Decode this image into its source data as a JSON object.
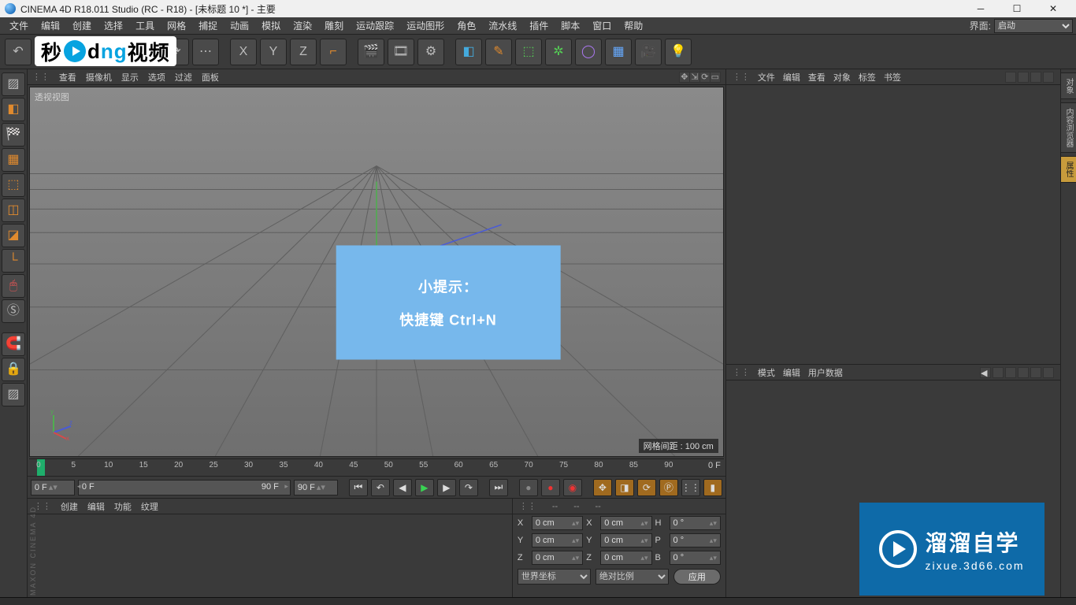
{
  "title": "CINEMA 4D R18.011 Studio (RC - R18) - [未标题 10 *] - 主要",
  "menubar": {
    "items": [
      "文件",
      "编辑",
      "创建",
      "选择",
      "工具",
      "网格",
      "捕捉",
      "动画",
      "模拟",
      "渲染",
      "雕刻",
      "运动跟踪",
      "运动图形",
      "角色",
      "流水线",
      "插件",
      "脚本",
      "窗口",
      "帮助"
    ],
    "layout_label": "界面:",
    "layout_value": "启动"
  },
  "viewport_menu": {
    "items": [
      "查看",
      "摄像机",
      "显示",
      "选项",
      "过滤",
      "面板"
    ],
    "view_label": "透视视图",
    "grid_distance": "网格间距 : 100 cm"
  },
  "tip": {
    "title": "小提示：",
    "body": "快捷键 Ctrl+N"
  },
  "timeline": {
    "ticks": [
      "0",
      "5",
      "10",
      "15",
      "20",
      "25",
      "30",
      "35",
      "40",
      "45",
      "50",
      "55",
      "60",
      "65",
      "70",
      "75",
      "80",
      "85",
      "90"
    ],
    "end_label": "0 F"
  },
  "playbar": {
    "current": "0 F",
    "range_start": "0 F",
    "range_end": "90 F",
    "end_field": "90 F"
  },
  "material_panel": {
    "menu": [
      "创建",
      "编辑",
      "功能",
      "纹理"
    ],
    "brand": "MAXON CINEMA 4D"
  },
  "coord_panel": {
    "headers": [
      "--",
      "--",
      "--"
    ],
    "rows": [
      {
        "axis": "X",
        "pos": "0 cm",
        "size_axis": "X",
        "size": "0 cm",
        "rot_axis": "H",
        "rot": "0 °"
      },
      {
        "axis": "Y",
        "pos": "0 cm",
        "size_axis": "Y",
        "size": "0 cm",
        "rot_axis": "P",
        "rot": "0 °"
      },
      {
        "axis": "Z",
        "pos": "0 cm",
        "size_axis": "Z",
        "size": "0 cm",
        "rot_axis": "B",
        "rot": "0 °"
      }
    ],
    "coord_system": "世界坐标",
    "size_mode": "绝对比例",
    "apply": "应用"
  },
  "object_panel": {
    "menu": [
      "文件",
      "编辑",
      "查看",
      "对象",
      "标签",
      "书签"
    ]
  },
  "attr_panel": {
    "menu": [
      "模式",
      "编辑",
      "用户数据"
    ]
  },
  "right_tabs": [
    "对象",
    "内容浏览器",
    "属性"
  ],
  "watermark": {
    "big": "溜溜自学",
    "small": "zixue.3d66.com"
  },
  "axis_labels": {
    "x": "x",
    "y": "y",
    "z": "z"
  },
  "overlay_logo": {
    "a": "秒",
    "b": "d",
    "c": "ng",
    "d": "视频"
  }
}
